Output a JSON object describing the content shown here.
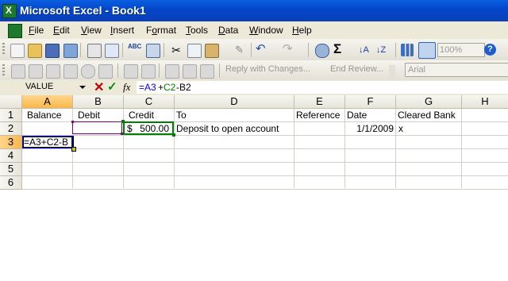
{
  "window": {
    "title": "Microsoft Excel - Book1"
  },
  "menu": [
    {
      "label": "File",
      "u": "F",
      "rest": "ile"
    },
    {
      "label": "Edit",
      "u": "E",
      "rest": "dit"
    },
    {
      "label": "View",
      "u": "V",
      "rest": "iew"
    },
    {
      "label": "Insert",
      "u": "I",
      "rest": "nsert"
    },
    {
      "label": "Format",
      "u": "o",
      "pre": "F",
      "rest": "rmat"
    },
    {
      "label": "Tools",
      "u": "T",
      "rest": "ools"
    },
    {
      "label": "Data",
      "u": "D",
      "rest": "ata"
    },
    {
      "label": "Window",
      "u": "W",
      "rest": "indow"
    },
    {
      "label": "Help",
      "u": "H",
      "rest": "elp"
    }
  ],
  "toolbar": {
    "zoom": "100%",
    "sigma": "Σ",
    "reply_with_changes": "Reply with Changes...",
    "end_review": "End Review...",
    "font": "Arial"
  },
  "formula_bar": {
    "name_box": "VALUE",
    "cancel": "✕",
    "enter": "✓",
    "fx": "fx",
    "formula_part1": "=A3",
    "formula_part2": "+",
    "formula_part3": "C2",
    "formula_part4": "-B2"
  },
  "columns": [
    "A",
    "B",
    "C",
    "D",
    "E",
    "F",
    "G",
    "H"
  ],
  "rows": [
    "1",
    "2",
    "3",
    "4",
    "5",
    "6"
  ],
  "cells": {
    "A1": "Balance",
    "B1": "Debit",
    "C1": "Credit",
    "D1": "To",
    "E1": "Reference",
    "F1": "Date",
    "G1": "Cleared Bank",
    "C2_currency": "$",
    "C2_value": "500.00",
    "D2": "Deposit to open account",
    "F2": "1/1/2009",
    "G2": "x",
    "A3_edit": "=A3+C2-B"
  },
  "colors": {
    "title_bar": "#0245c9",
    "formula_ref_blue": "#0000ff",
    "formula_ref_green": "#008000",
    "ref_border_purple": "#800080",
    "ref_border_green": "#008000"
  }
}
